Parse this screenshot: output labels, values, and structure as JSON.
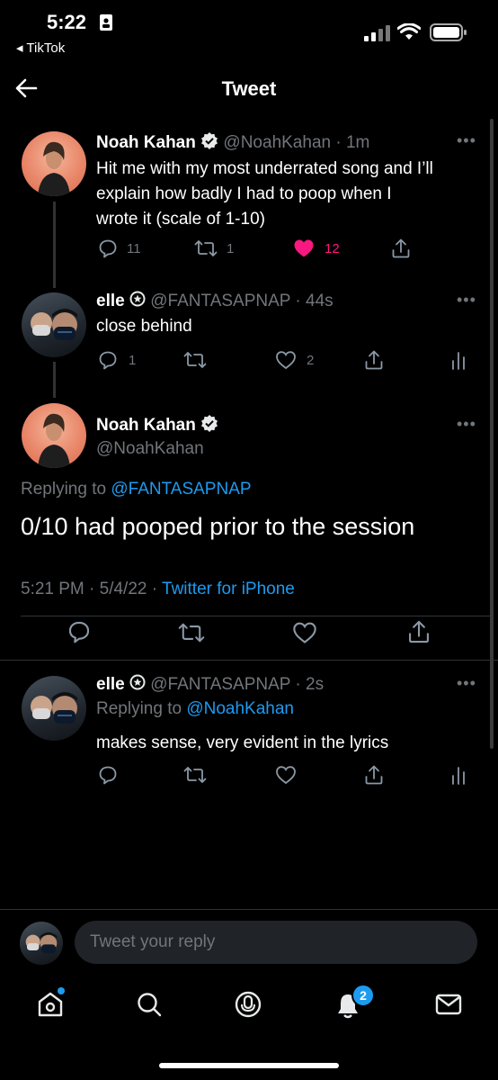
{
  "status_bar": {
    "time": "5:22",
    "back_app": "◂ TikTok"
  },
  "header": {
    "title": "Tweet"
  },
  "tweets": {
    "original": {
      "name": "Noah Kahan",
      "handle": "@NoahKahan",
      "time": "· 1m",
      "text_lines": [
        "Hit me with my most underrated song and I’ll",
        "explain how badly I had to poop when I",
        "wrote it (scale of 1-10)"
      ],
      "replies": "11",
      "retweets": "1",
      "likes": "12"
    },
    "reply1": {
      "name": "elle",
      "handle": "@FANTASAPNAP",
      "time": "· 44s",
      "text": "close behind",
      "replies": "1",
      "likes": "2"
    },
    "main": {
      "name": "Noah Kahan",
      "handle": "@NoahKahan",
      "replying_prefix": "Replying to",
      "replying_to": "@FANTASAPNAP",
      "text": "0/10 had pooped prior to the session",
      "timestamp": "5:21 PM · 5/4/22 ·",
      "source": "Twitter for iPhone"
    },
    "reply2": {
      "name": "elle",
      "handle": "@FANTASAPNAP",
      "time": "· 2s",
      "replying_prefix": "Replying to",
      "replying_to": "@NoahKahan",
      "text": "makes sense, very evident in the lyrics"
    }
  },
  "composer": {
    "placeholder": "Tweet your reply"
  },
  "bottom_nav": {
    "notifications_badge": "2"
  },
  "colors": {
    "accent": "#1d9bf0",
    "like": "#f91880",
    "muted": "#71767b",
    "background": "#000000"
  }
}
